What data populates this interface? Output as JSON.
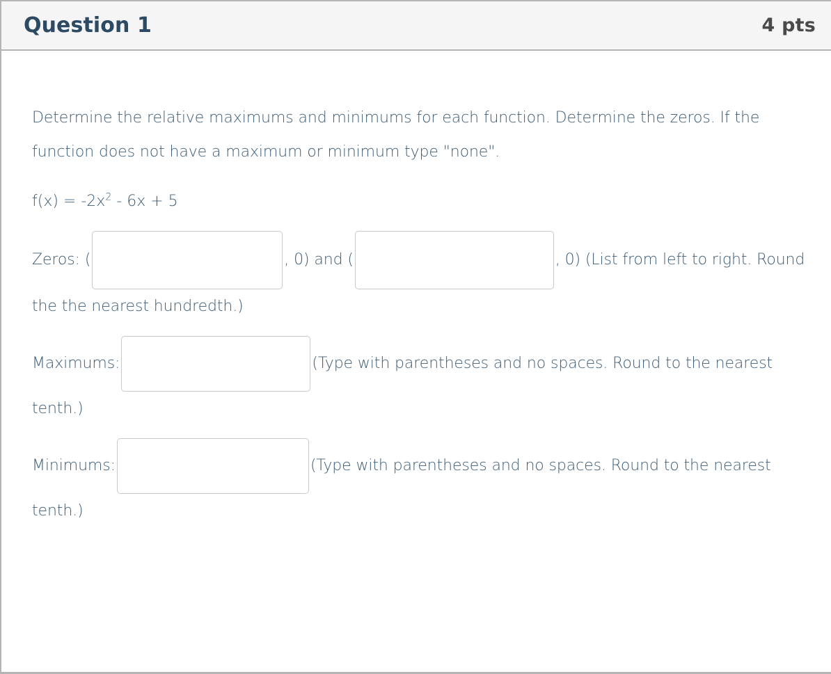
{
  "header": {
    "title": "Question 1",
    "points": "4 pts"
  },
  "body": {
    "prompt": "Determine the relative maximums and minimums for each function.  Determine the zeros. If the function does not have a maximum or minimum type \"none\".",
    "equation": {
      "prefix": "f(x) = -2x",
      "exponent": "2",
      "suffix": " - 6x + 5"
    },
    "zeros": {
      "label": "Zeros:",
      "open_paren_1": "(",
      "mid_text": ", 0) and (",
      "close_text": ", 0) (List from left to right. Round the the nearest hundredth.)",
      "input_1_value": "",
      "input_1_placeholder": "",
      "input_2_value": "",
      "input_2_placeholder": ""
    },
    "maximums": {
      "label": "Maximums:",
      "hint": "(Type with parentheses and no spaces. Round to the nearest tenth.)",
      "input_value": "",
      "input_placeholder": ""
    },
    "minimums": {
      "label": "Minimums:",
      "hint": "(Type with parentheses and no spaces. Round to the nearest tenth.)",
      "input_value": "",
      "input_placeholder": ""
    }
  },
  "colors": {
    "header_background": "#f5f5f5",
    "header_border": "#b4b4b4",
    "title_text": "#2c4a63",
    "points_text": "#4a4a4a",
    "body_text": "#3d5d77",
    "input_border": "#c9c9c9"
  }
}
